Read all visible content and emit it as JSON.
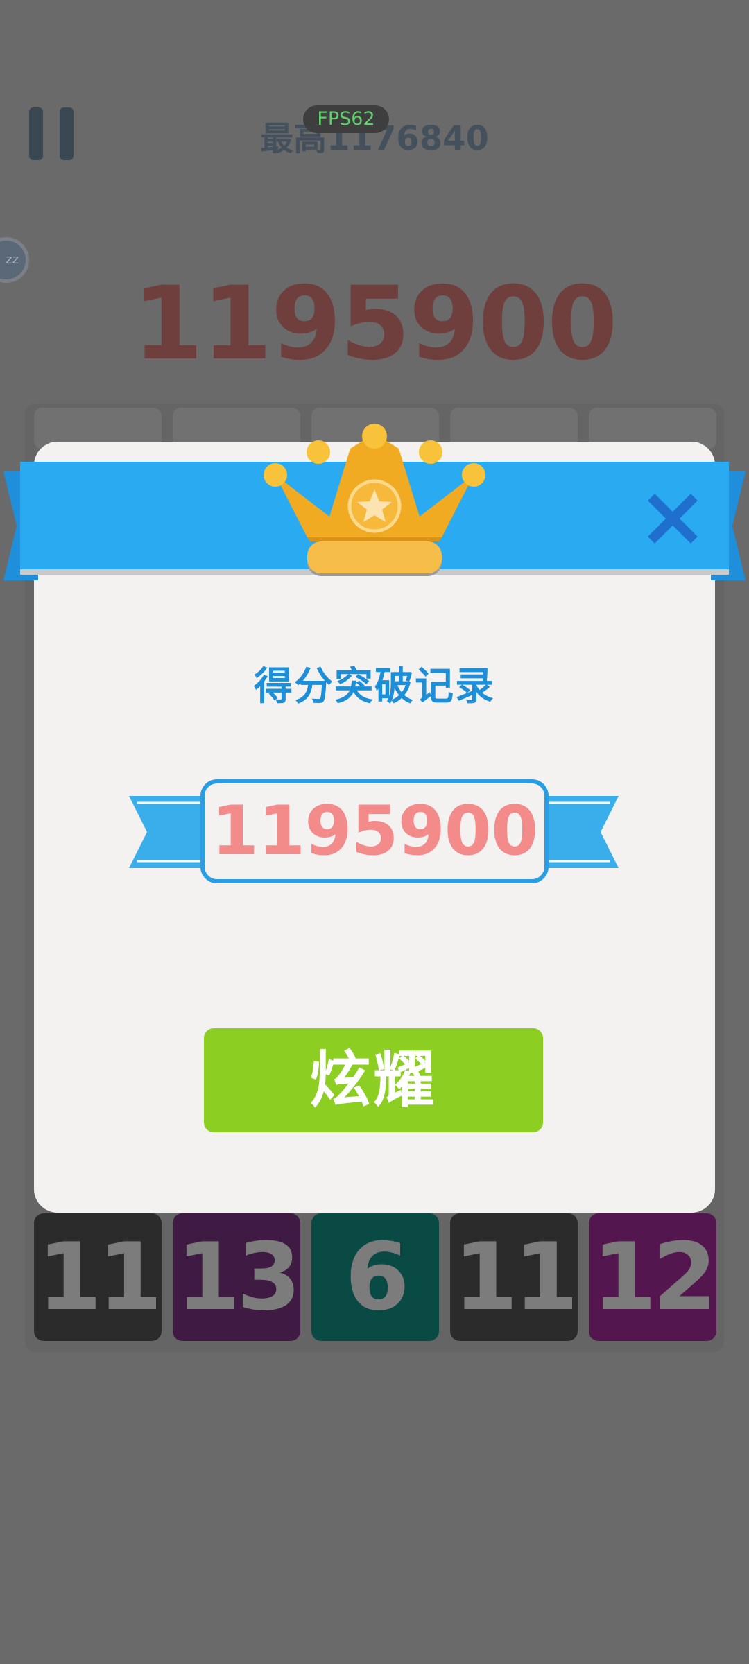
{
  "hud": {
    "best_label": "最高1176840",
    "fps_label": "FPS62",
    "zz_label": "zz",
    "current_score": "1195900"
  },
  "board": {
    "bottom_tiles": [
      {
        "value": "11",
        "color": "#2b2b2b"
      },
      {
        "value": "13",
        "color": "#3f1a43"
      },
      {
        "value": "6",
        "color": "#0a4a45"
      },
      {
        "value": "11",
        "color": "#2b2b2b"
      },
      {
        "value": "12",
        "color": "#54164f"
      }
    ]
  },
  "dialog": {
    "title": "得分突破记录",
    "score": "1195900",
    "share_label": "炫耀",
    "accent_color": "#2aabf1",
    "button_color": "#8ccf22",
    "crown_color": "#f0ab22"
  },
  "icons": {
    "pause": "pause-icon",
    "close": "close-icon",
    "crown": "crown-icon",
    "star": "star-icon"
  }
}
